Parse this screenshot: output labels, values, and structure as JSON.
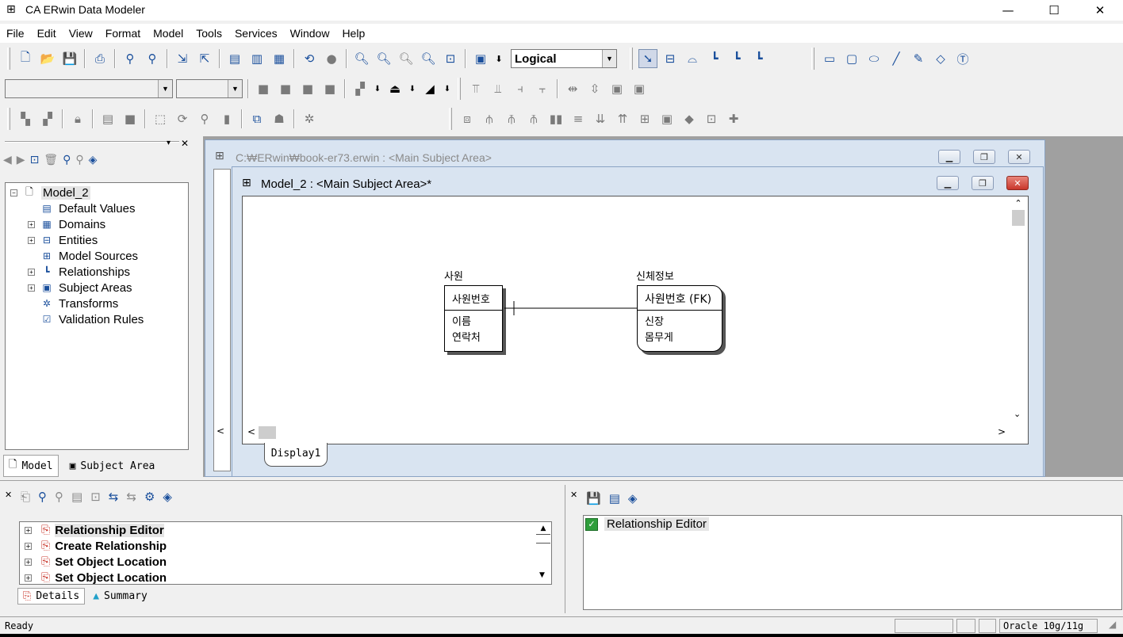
{
  "window": {
    "title": "CA ERwin Data Modeler",
    "minimize": "—",
    "maximize": "☐",
    "close": "✕"
  },
  "menu": [
    "File",
    "Edit",
    "View",
    "Format",
    "Model",
    "Tools",
    "Services",
    "Window",
    "Help"
  ],
  "toolbar": {
    "view_mode": "Logical"
  },
  "explorer": {
    "root": "Model_2",
    "items": [
      {
        "label": "Default Values",
        "expandable": false,
        "icon": "default-values-icon"
      },
      {
        "label": "Domains",
        "expandable": true,
        "icon": "domains-icon"
      },
      {
        "label": "Entities",
        "expandable": true,
        "icon": "entities-icon"
      },
      {
        "label": "Model Sources",
        "expandable": false,
        "icon": "model-sources-icon"
      },
      {
        "label": "Relationships",
        "expandable": true,
        "icon": "relationships-icon"
      },
      {
        "label": "Subject Areas",
        "expandable": true,
        "icon": "subject-areas-icon"
      },
      {
        "label": "Transforms",
        "expandable": false,
        "icon": "transforms-icon"
      },
      {
        "label": "Validation Rules",
        "expandable": false,
        "icon": "validation-rules-icon"
      }
    ],
    "tabs": [
      "Model",
      "Subject Area"
    ]
  },
  "back_window": {
    "title": "C:₩ERwin₩book-er73.erwin : <Main Subject Area>"
  },
  "front_window": {
    "title": "Model_2 : <Main Subject Area>*",
    "tab": "Display1"
  },
  "diagram": {
    "entities": [
      {
        "name": "사원",
        "key": "사원번호",
        "attributes": [
          "이름",
          "연락처"
        ]
      },
      {
        "name": "신체정보",
        "key": "사원번호 (FK)",
        "attributes": [
          "신장",
          "몸무게"
        ]
      }
    ]
  },
  "action_log": {
    "items": [
      "Relationship Editor",
      "Create Relationship",
      "Set Object Location",
      "Set Object Location"
    ],
    "tabs": [
      "Details",
      "Summary"
    ]
  },
  "detail_panel": {
    "item": "Relationship Editor"
  },
  "statusbar": {
    "text": "Ready",
    "db": "Oracle 10g/11g"
  },
  "colors": {
    "accent": "#1a4f9c",
    "close_red": "#c9372c"
  }
}
